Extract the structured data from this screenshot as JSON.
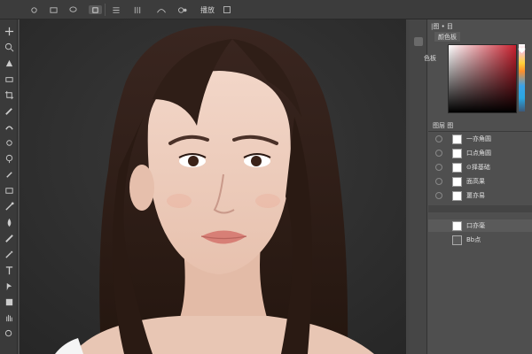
{
  "options_bar": {
    "items": [
      {
        "icon": "move-icon"
      },
      {
        "icon": "rect-select-icon"
      },
      {
        "icon": "lasso-icon"
      },
      {
        "icon": "transform-icon",
        "selected": true
      },
      {
        "icon": "align-icon"
      },
      {
        "icon": "distribute-icon"
      },
      {
        "icon": "warp-icon"
      },
      {
        "icon": "3d-icon"
      }
    ],
    "label": "播放"
  },
  "tools": [
    "move-icon",
    "zoom-icon",
    "lasso-icon",
    "magic-wand-icon",
    "crop-icon",
    "eyedropper-icon",
    "healing-icon",
    "brush-icon",
    "stamp-icon",
    "history-brush-icon",
    "eraser-icon",
    "gradient-icon",
    "blur-icon",
    "dodge-icon",
    "pen-icon",
    "text-icon",
    "path-select-icon",
    "shape-icon",
    "hand-icon",
    "zoom-out-icon"
  ],
  "color_panel": {
    "header": "|图 • 目",
    "tab": "颜色板",
    "side_label": "色板",
    "colors": {
      "base": "#c8202e"
    }
  },
  "layers_panel": {
    "header": "图层 图",
    "layers": [
      {
        "name": "一亦角圆"
      },
      {
        "name": "口点角圆"
      },
      {
        "name": "⊙择基础"
      },
      {
        "name": "面高果"
      },
      {
        "name": "噩亦易"
      }
    ]
  },
  "channels_panel": {
    "layers": [
      {
        "name": "口亦毫",
        "thumb": "white"
      },
      {
        "name": "Bb点",
        "thumb": "dark"
      }
    ]
  }
}
